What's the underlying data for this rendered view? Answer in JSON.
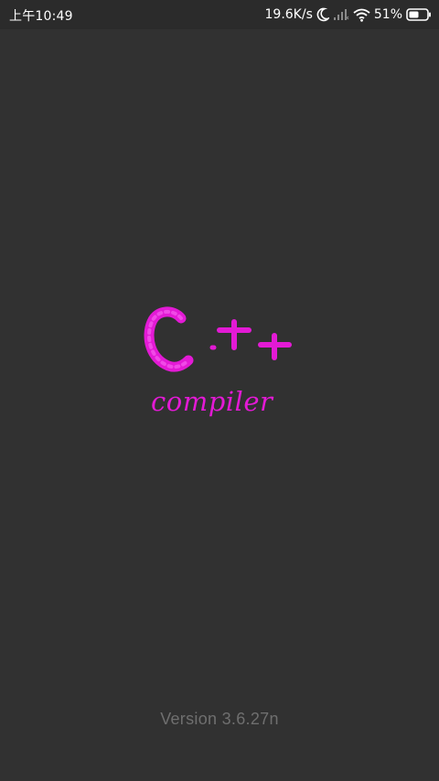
{
  "status_bar": {
    "time": "上午10:49",
    "network_speed": "19.6K/s",
    "battery_percent": "51%",
    "icons": [
      "moon-icon",
      "signal-icon",
      "wifi-icon",
      "battery-icon"
    ]
  },
  "splash": {
    "logo_main": "C++",
    "logo_sub": "compiler",
    "version": "Version 3.6.27n"
  },
  "colors": {
    "background": "#313131",
    "accent": "#e31ad5",
    "version_text": "#6f6f6f",
    "status_text": "#ffffff"
  }
}
